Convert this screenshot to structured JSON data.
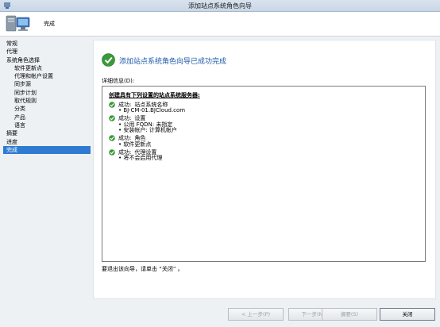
{
  "window": {
    "title": "添加站点系统角色向导"
  },
  "header": {
    "page_title": "完成"
  },
  "sidebar": {
    "items": [
      {
        "label": "常规",
        "level": 0,
        "selected": false
      },
      {
        "label": "代理",
        "level": 0,
        "selected": false
      },
      {
        "label": "系统角色选择",
        "level": 0,
        "selected": false
      },
      {
        "label": "软件更新点",
        "level": 1,
        "selected": false
      },
      {
        "label": "代理和帐户设置",
        "level": 1,
        "selected": false
      },
      {
        "label": "同步源",
        "level": 1,
        "selected": false
      },
      {
        "label": "同步计划",
        "level": 1,
        "selected": false
      },
      {
        "label": "取代规则",
        "level": 1,
        "selected": false
      },
      {
        "label": "分类",
        "level": 1,
        "selected": false
      },
      {
        "label": "产品",
        "level": 1,
        "selected": false
      },
      {
        "label": "语言",
        "level": 1,
        "selected": false
      },
      {
        "label": "摘要",
        "level": 0,
        "selected": false
      },
      {
        "label": "进度",
        "level": 0,
        "selected": false
      },
      {
        "label": "完成",
        "level": 0,
        "selected": true
      }
    ]
  },
  "main": {
    "heading": "添加站点系统角色向导已成功完成",
    "details_label": "详细信息(D):",
    "report_title": "创建具有下列设置的站点系统服务器:",
    "groups": [
      {
        "status": "成功:",
        "name": "站点系统名称",
        "items": [
          "BJ-CM-01.BJCloud.com"
        ]
      },
      {
        "status": "成功:",
        "name": "设置",
        "items": [
          "公用 FQDN: 未指定",
          "安装帐户: 计算机帐户"
        ]
      },
      {
        "status": "成功:",
        "name": "角色",
        "items": [
          "软件更新点"
        ]
      },
      {
        "status": "成功:",
        "name": "代理设置",
        "items": [
          "将不会启用代理"
        ]
      }
    ],
    "footer_text": "要退出该向导，请单击 “关闭” 。"
  },
  "buttons": {
    "previous": "< 上一步(P)",
    "next": "下一步(N) >",
    "summary": "摘要(S)",
    "close": "关闭"
  }
}
